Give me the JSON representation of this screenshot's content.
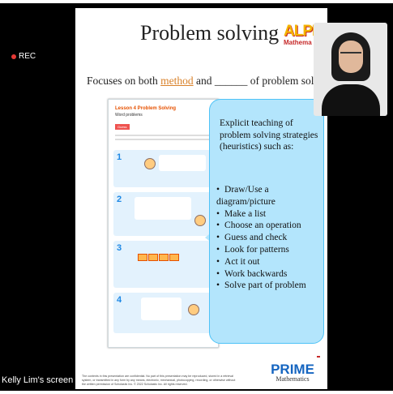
{
  "recording": {
    "label": "REC"
  },
  "slide": {
    "title": "Problem solving",
    "logo": {
      "text": "ALPH",
      "subtext": "Mathema"
    },
    "subtitle": {
      "prefix": "Focuses on both ",
      "method": "method",
      "middle": " and ______ of problem solvin"
    },
    "textbook_page": {
      "lesson": "Lesson 4  Problem Solving",
      "section": "Word problems",
      "badge": "Guess"
    },
    "callout": {
      "heading": "Explicit teaching of problem solving strategies (heuristics) such as:",
      "items": [
        "Draw/Use a diagram/picture",
        "Make a list",
        "Choose an operation",
        "Guess and check",
        "Look for patterns",
        "Act it out",
        "Work backwards",
        "Solve part of problem"
      ]
    },
    "footer": "The contents in this presentation are confidential. No part of this presentation may be reproduced, stored in a retrieval system, or transmitted in any form by any means, electronic, mechanical, photocopying, recording, or otherwise without the written permission of Scholastic Inc. © 2022 Scholastic Inc. All rights reserved.",
    "brand": {
      "name": "PRIME",
      "subname": "Mathematics"
    }
  },
  "participant": {
    "name": "Kelly Lim's screen"
  }
}
